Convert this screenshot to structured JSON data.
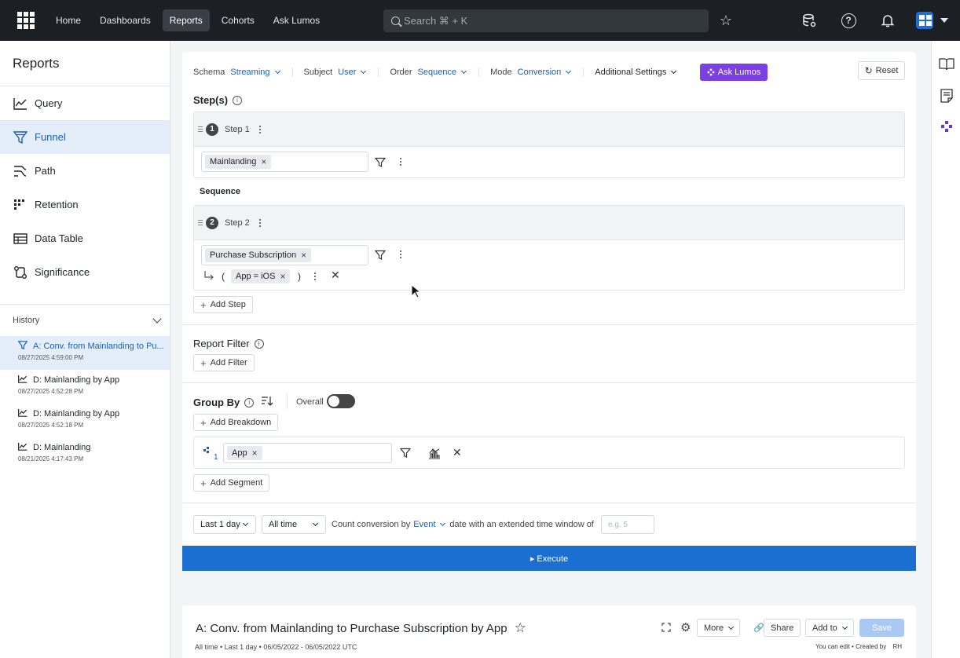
{
  "nav": {
    "links": [
      "Home",
      "Dashboards",
      "Reports",
      "Cohorts",
      "Ask Lumos"
    ],
    "active": "Reports",
    "search_placeholder": "Search ⌘ + K"
  },
  "sidebar": {
    "title": "Reports",
    "items": [
      "Query",
      "Funnel",
      "Path",
      "Retention",
      "Data Table",
      "Significance"
    ],
    "active": "Funnel",
    "history_label": "History",
    "history": [
      {
        "title": "A: Conv. from Mainlanding to Pu...",
        "date": "08/27/2025 4:59:00 PM"
      },
      {
        "title": "D: Mainlanding by App",
        "date": "08/27/2025 4:52:28 PM"
      },
      {
        "title": "D: Mainlanding by App",
        "date": "08/27/2025 4:52:18 PM"
      },
      {
        "title": "D: Mainlanding",
        "date": "08/21/2025 4:17:43 PM"
      }
    ]
  },
  "toolbar": {
    "schema_label": "Schema",
    "schema_value": "Streaming",
    "subject_label": "Subject",
    "subject_value": "User",
    "order_label": "Order",
    "order_value": "Sequence",
    "mode_label": "Mode",
    "mode_value": "Conversion",
    "additional": "Additional Settings",
    "ask_lumos": "Ask Lumos",
    "reset": "Reset"
  },
  "steps": {
    "title": "Step(s)",
    "step1": {
      "num": "1",
      "label": "Step 1",
      "event": "Mainlanding"
    },
    "sequence_label": "Sequence",
    "step2": {
      "num": "2",
      "label": "Step 2",
      "event": "Purchase Subscription",
      "open_paren": "(",
      "filter": "App = iOS",
      "close_paren": ")"
    },
    "add_step": "Add Step"
  },
  "report_filter": {
    "title": "Report Filter",
    "add_filter": "Add Filter"
  },
  "group_by": {
    "title": "Group By",
    "overall_label": "Overall",
    "add_breakdown": "Add Breakdown",
    "breakdown_index": "1",
    "breakdown_prop": "App",
    "add_segment": "Add Segment"
  },
  "time": {
    "range": "Last 1 day",
    "alltime": "All time",
    "count_label": "Count conversion by",
    "count_value": "Event",
    "window_label": "date with an extended time window of",
    "window_placeholder": "e.g. 5"
  },
  "execute": "▸ Execute",
  "result": {
    "title": "A: Conv. from Mainlanding to Purchase Subscription by App",
    "meta": "All time • Last 1 day • 06/05/2022 - 06/05/2022 UTC",
    "more": "More",
    "share": "Share",
    "add_to": "Add to",
    "save": "Save",
    "edit_note": "You can edit • Created by",
    "creator": "RH"
  },
  "colors": {
    "accent": "#1a6fd1",
    "ask_lumos": "#7b3fe4",
    "topnav": "#1c1f24"
  }
}
